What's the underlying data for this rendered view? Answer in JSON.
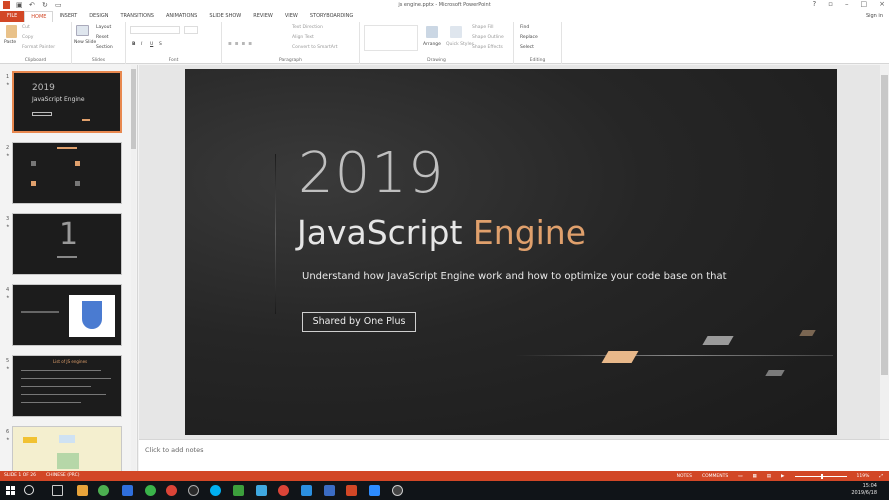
{
  "window": {
    "title": "js engine.pptx - Microsoft PowerPoint",
    "signin": "Sign in"
  },
  "tabs": [
    "FILE",
    "HOME",
    "INSERT",
    "DESIGN",
    "TRANSITIONS",
    "ANIMATIONS",
    "SLIDE SHOW",
    "REVIEW",
    "VIEW",
    "STORYBOARDING"
  ],
  "ribbon": {
    "clipboard": {
      "label": "Clipboard",
      "paste": "Paste",
      "cut": "Cut",
      "copy": "Copy",
      "format_painter": "Format Painter"
    },
    "slides": {
      "label": "Slides",
      "new_slide": "New Slide",
      "layout": "Layout",
      "reset": "Reset",
      "section": "Section"
    },
    "font": {
      "label": "Font"
    },
    "paragraph": {
      "label": "Paragraph",
      "text_direction": "Text Direction",
      "align_text": "Align Text",
      "convert_smartart": "Convert to SmartArt"
    },
    "drawing": {
      "label": "Drawing",
      "arrange": "Arrange",
      "quick_styles": "Quick Styles",
      "shape_fill": "Shape Fill",
      "shape_outline": "Shape Outline",
      "shape_effects": "Shape Effects"
    },
    "editing": {
      "label": "Editing",
      "find": "Find",
      "replace": "Replace",
      "select": "Select"
    }
  },
  "thumbnails": [
    {
      "num": "1",
      "title": "2019",
      "subtitle": "JavaScript Engine"
    },
    {
      "num": "2"
    },
    {
      "num": "3"
    },
    {
      "num": "4"
    },
    {
      "num": "5",
      "title": "List of JS engines"
    },
    {
      "num": "6"
    }
  ],
  "slide": {
    "year": "2019",
    "title_main": "JavaScript ",
    "title_accent": "Engine",
    "subtitle": "Understand how JavaScript Engine work and how to optimize your code base on that",
    "button": "Shared by One Plus"
  },
  "notes_placeholder": "Click to add notes",
  "status": {
    "slide": "SLIDE 1 OF 26",
    "language": "CHINESE (PRC)",
    "notes": "NOTES",
    "comments": "COMMENTS",
    "zoom": "119%"
  },
  "clock": {
    "time": "15:04",
    "date": "2019/6/18"
  },
  "colors": {
    "accent": "#d24726",
    "slide_accent": "#e0a06c"
  }
}
